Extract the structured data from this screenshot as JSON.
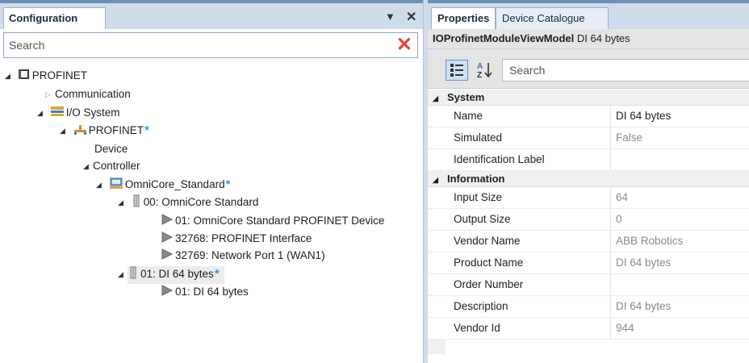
{
  "left": {
    "tab_title": "Configuration",
    "pin_symbol": "▼",
    "close_symbol": "✕",
    "search_placeholder": "Search",
    "tree": {
      "profinet_root": "PROFINET",
      "communication": "Communication",
      "io_system": "I/O System",
      "profinet_network": "PROFINET",
      "device": "Device",
      "controller": "Controller",
      "omnicore_controller": "OmniCore_Standard",
      "module_00": "00: OmniCore Standard",
      "sub_01": "01: OmniCore Standard PROFINET Device",
      "sub_32768": "32768: PROFINET Interface",
      "sub_32769": "32769: Network Port 1 (WAN1)",
      "module_01": "01: DI 64 bytes",
      "sub_di": "01: DI 64 bytes",
      "modified_marker": "*"
    }
  },
  "right": {
    "tabs": [
      "Properties",
      "Device Catalogue"
    ],
    "object_type": "IOProfinetModuleViewModel",
    "object_name": "DI 64 bytes",
    "search_placeholder": "Search",
    "sort_label": "A Z",
    "categories": [
      {
        "name": "System",
        "rows": [
          {
            "key": "Name",
            "value": "DI 64 bytes",
            "dark": true
          },
          {
            "key": "Simulated",
            "value": "False",
            "dark": false
          },
          {
            "key": "Identification Label",
            "value": "",
            "dark": false
          }
        ]
      },
      {
        "name": "Information",
        "rows": [
          {
            "key": "Input Size",
            "value": "64",
            "dark": false
          },
          {
            "key": "Output Size",
            "value": "0",
            "dark": false
          },
          {
            "key": "Vendor Name",
            "value": "ABB Robotics",
            "dark": false
          },
          {
            "key": "Product Name",
            "value": "DI 64 bytes",
            "dark": false
          },
          {
            "key": "Order Number",
            "value": "",
            "dark": false
          },
          {
            "key": "Description",
            "value": "DI 64 bytes",
            "dark": false
          },
          {
            "key": "Vendor Id",
            "value": "944",
            "dark": false
          }
        ]
      }
    ]
  },
  "colors": {
    "accent": "#6d8fb5",
    "header_bg": "#cfdcec",
    "modified_star": "#2b9be0",
    "clear_x": "#e34234"
  }
}
